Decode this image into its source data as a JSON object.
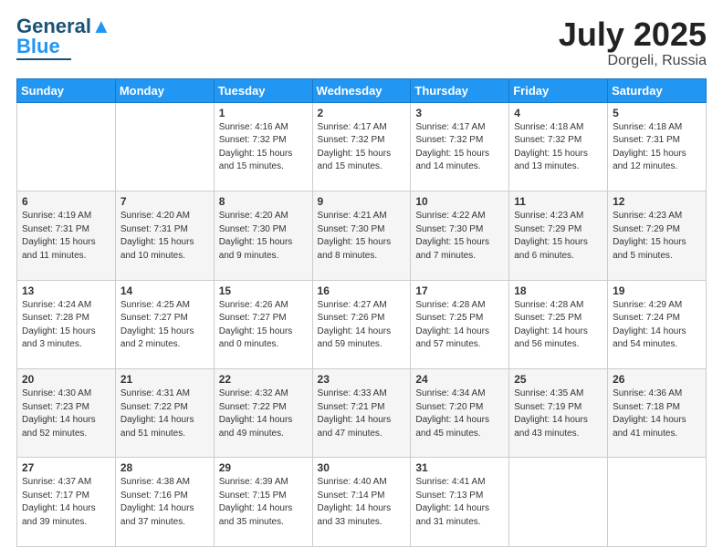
{
  "header": {
    "logo_text1": "General",
    "logo_text2": "Blue",
    "month_year": "July 2025",
    "location": "Dorgeli, Russia"
  },
  "weekdays": [
    "Sunday",
    "Monday",
    "Tuesday",
    "Wednesday",
    "Thursday",
    "Friday",
    "Saturday"
  ],
  "weeks": [
    [
      {
        "day": "",
        "info": ""
      },
      {
        "day": "",
        "info": ""
      },
      {
        "day": "1",
        "info": "Sunrise: 4:16 AM\nSunset: 7:32 PM\nDaylight: 15 hours and 15 minutes."
      },
      {
        "day": "2",
        "info": "Sunrise: 4:17 AM\nSunset: 7:32 PM\nDaylight: 15 hours and 15 minutes."
      },
      {
        "day": "3",
        "info": "Sunrise: 4:17 AM\nSunset: 7:32 PM\nDaylight: 15 hours and 14 minutes."
      },
      {
        "day": "4",
        "info": "Sunrise: 4:18 AM\nSunset: 7:32 PM\nDaylight: 15 hours and 13 minutes."
      },
      {
        "day": "5",
        "info": "Sunrise: 4:18 AM\nSunset: 7:31 PM\nDaylight: 15 hours and 12 minutes."
      }
    ],
    [
      {
        "day": "6",
        "info": "Sunrise: 4:19 AM\nSunset: 7:31 PM\nDaylight: 15 hours and 11 minutes."
      },
      {
        "day": "7",
        "info": "Sunrise: 4:20 AM\nSunset: 7:31 PM\nDaylight: 15 hours and 10 minutes."
      },
      {
        "day": "8",
        "info": "Sunrise: 4:20 AM\nSunset: 7:30 PM\nDaylight: 15 hours and 9 minutes."
      },
      {
        "day": "9",
        "info": "Sunrise: 4:21 AM\nSunset: 7:30 PM\nDaylight: 15 hours and 8 minutes."
      },
      {
        "day": "10",
        "info": "Sunrise: 4:22 AM\nSunset: 7:30 PM\nDaylight: 15 hours and 7 minutes."
      },
      {
        "day": "11",
        "info": "Sunrise: 4:23 AM\nSunset: 7:29 PM\nDaylight: 15 hours and 6 minutes."
      },
      {
        "day": "12",
        "info": "Sunrise: 4:23 AM\nSunset: 7:29 PM\nDaylight: 15 hours and 5 minutes."
      }
    ],
    [
      {
        "day": "13",
        "info": "Sunrise: 4:24 AM\nSunset: 7:28 PM\nDaylight: 15 hours and 3 minutes."
      },
      {
        "day": "14",
        "info": "Sunrise: 4:25 AM\nSunset: 7:27 PM\nDaylight: 15 hours and 2 minutes."
      },
      {
        "day": "15",
        "info": "Sunrise: 4:26 AM\nSunset: 7:27 PM\nDaylight: 15 hours and 0 minutes."
      },
      {
        "day": "16",
        "info": "Sunrise: 4:27 AM\nSunset: 7:26 PM\nDaylight: 14 hours and 59 minutes."
      },
      {
        "day": "17",
        "info": "Sunrise: 4:28 AM\nSunset: 7:25 PM\nDaylight: 14 hours and 57 minutes."
      },
      {
        "day": "18",
        "info": "Sunrise: 4:28 AM\nSunset: 7:25 PM\nDaylight: 14 hours and 56 minutes."
      },
      {
        "day": "19",
        "info": "Sunrise: 4:29 AM\nSunset: 7:24 PM\nDaylight: 14 hours and 54 minutes."
      }
    ],
    [
      {
        "day": "20",
        "info": "Sunrise: 4:30 AM\nSunset: 7:23 PM\nDaylight: 14 hours and 52 minutes."
      },
      {
        "day": "21",
        "info": "Sunrise: 4:31 AM\nSunset: 7:22 PM\nDaylight: 14 hours and 51 minutes."
      },
      {
        "day": "22",
        "info": "Sunrise: 4:32 AM\nSunset: 7:22 PM\nDaylight: 14 hours and 49 minutes."
      },
      {
        "day": "23",
        "info": "Sunrise: 4:33 AM\nSunset: 7:21 PM\nDaylight: 14 hours and 47 minutes."
      },
      {
        "day": "24",
        "info": "Sunrise: 4:34 AM\nSunset: 7:20 PM\nDaylight: 14 hours and 45 minutes."
      },
      {
        "day": "25",
        "info": "Sunrise: 4:35 AM\nSunset: 7:19 PM\nDaylight: 14 hours and 43 minutes."
      },
      {
        "day": "26",
        "info": "Sunrise: 4:36 AM\nSunset: 7:18 PM\nDaylight: 14 hours and 41 minutes."
      }
    ],
    [
      {
        "day": "27",
        "info": "Sunrise: 4:37 AM\nSunset: 7:17 PM\nDaylight: 14 hours and 39 minutes."
      },
      {
        "day": "28",
        "info": "Sunrise: 4:38 AM\nSunset: 7:16 PM\nDaylight: 14 hours and 37 minutes."
      },
      {
        "day": "29",
        "info": "Sunrise: 4:39 AM\nSunset: 7:15 PM\nDaylight: 14 hours and 35 minutes."
      },
      {
        "day": "30",
        "info": "Sunrise: 4:40 AM\nSunset: 7:14 PM\nDaylight: 14 hours and 33 minutes."
      },
      {
        "day": "31",
        "info": "Sunrise: 4:41 AM\nSunset: 7:13 PM\nDaylight: 14 hours and 31 minutes."
      },
      {
        "day": "",
        "info": ""
      },
      {
        "day": "",
        "info": ""
      }
    ]
  ]
}
